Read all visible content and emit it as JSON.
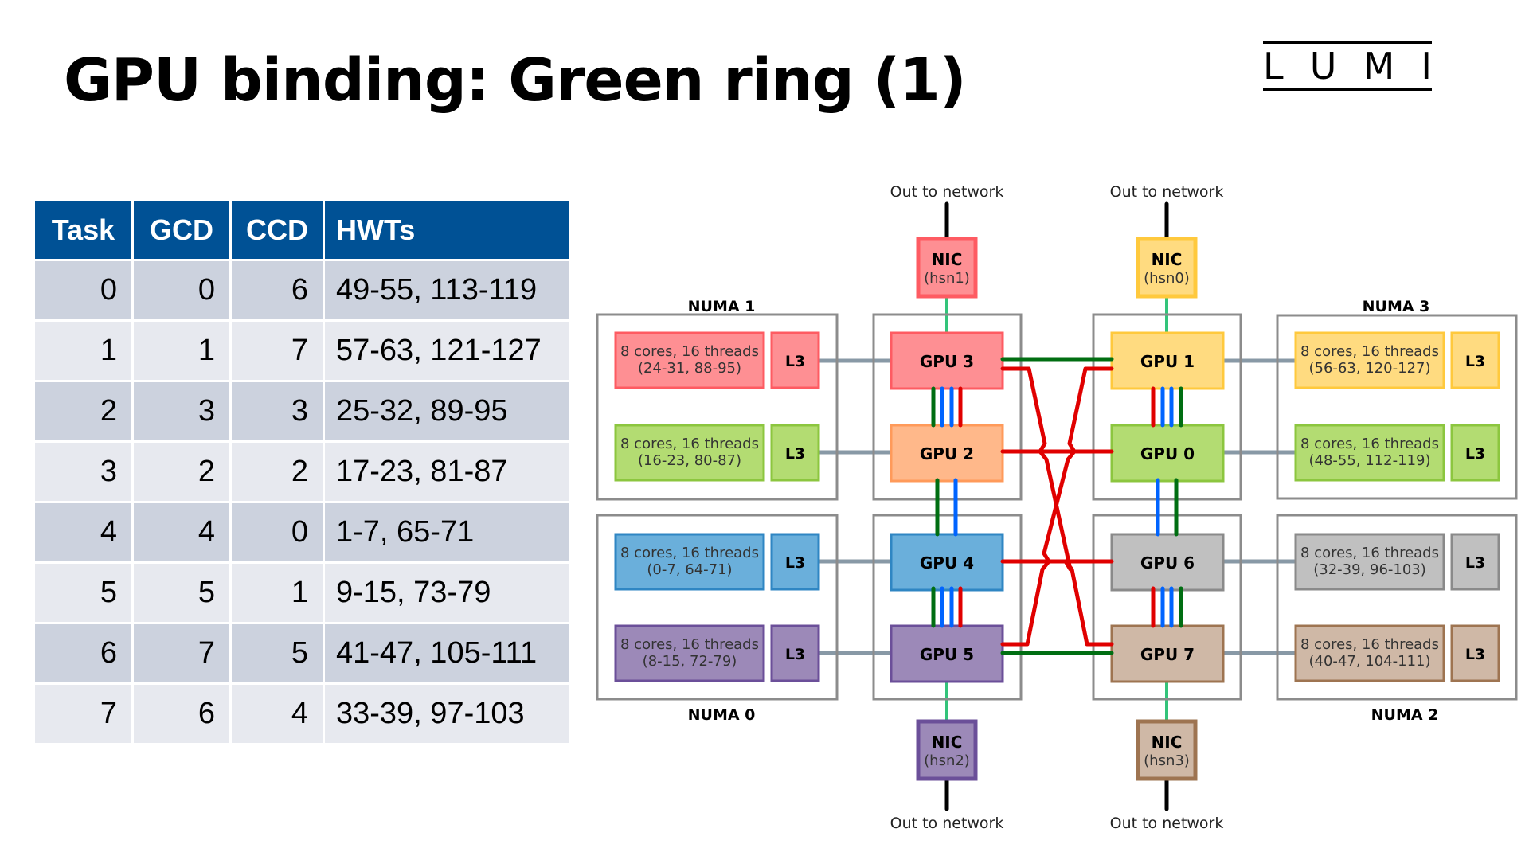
{
  "title": "GPU binding: Green ring (1)",
  "logo": {
    "letters": [
      "L",
      "U",
      "M",
      "I"
    ]
  },
  "table": {
    "headers": [
      "Task",
      "GCD",
      "CCD",
      "HWTs"
    ],
    "rows": [
      [
        "0",
        "0",
        "6",
        "49-55, 113-119"
      ],
      [
        "1",
        "1",
        "7",
        "57-63, 121-127"
      ],
      [
        "2",
        "3",
        "3",
        "25-32, 89-95"
      ],
      [
        "3",
        "2",
        "2",
        "17-23, 81-87"
      ],
      [
        "4",
        "4",
        "0",
        "1-7, 65-71"
      ],
      [
        "5",
        "5",
        "1",
        "9-15, 73-79"
      ],
      [
        "6",
        "7",
        "5",
        "41-47, 105-111"
      ],
      [
        "7",
        "6",
        "4",
        "33-39, 97-103"
      ]
    ]
  },
  "diagram": {
    "network_label": "Out to network",
    "numa": {
      "numa1": "NUMA 1",
      "numa3": "NUMA 3",
      "numa0": "NUMA 0",
      "numa2": "NUMA 2"
    },
    "nics": {
      "hsn1": {
        "title": "NIC",
        "name": "(hsn1)",
        "fill": "#fe8f93",
        "stroke": "#fe5b62"
      },
      "hsn0": {
        "title": "NIC",
        "name": "(hsn0)",
        "fill": "#ffdb80",
        "stroke": "#ffc93d"
      },
      "hsn2": {
        "title": "NIC",
        "name": "(hsn2)",
        "fill": "#9c89b8",
        "stroke": "#6b4f99"
      },
      "hsn3": {
        "title": "NIC",
        "name": "(hsn3)",
        "fill": "#cfb8a6",
        "stroke": "#9e7451"
      }
    },
    "gpus": {
      "gpu3": {
        "label": "GPU 3",
        "fill": "#fe8f93",
        "stroke": "#fe5b62"
      },
      "gpu2": {
        "label": "GPU 2",
        "fill": "#ffb88a",
        "stroke": "#ff9a5a"
      },
      "gpu4": {
        "label": "GPU 4",
        "fill": "#6aafdb",
        "stroke": "#2f86c3"
      },
      "gpu5": {
        "label": "GPU 5",
        "fill": "#9c89b8",
        "stroke": "#6b4f99"
      },
      "gpu1": {
        "label": "GPU 1",
        "fill": "#ffdb80",
        "stroke": "#ffc93d"
      },
      "gpu0": {
        "label": "GPU 0",
        "fill": "#b3dc72",
        "stroke": "#8cc63f"
      },
      "gpu6": {
        "label": "GPU 6",
        "fill": "#c0c0c0",
        "stroke": "#8a8a8a"
      },
      "gpu7": {
        "label": "GPU 7",
        "fill": "#cfb8a6",
        "stroke": "#9e7451"
      }
    },
    "ccds": {
      "n1_top": {
        "line1": "8  cores, 16 threads",
        "line2": "(24-31, 88-95)",
        "l3": "L3"
      },
      "n1_bot": {
        "line1": "8  cores, 16 threads",
        "line2": "(16-23, 80-87)",
        "l3": "L3"
      },
      "n0_top": {
        "line1": "8  cores, 16 threads",
        "line2": "(0-7, 64-71)",
        "l3": "L3"
      },
      "n0_bot": {
        "line1": "8  cores, 16 threads",
        "line2": "(8-15, 72-79)",
        "l3": "L3"
      },
      "n3_top": {
        "line1": "8  cores, 16 threads",
        "line2": "(56-63, 120-127)",
        "l3": "L3"
      },
      "n3_bot": {
        "line1": "8  cores, 16 threads",
        "line2": "(48-55, 112-119)",
        "l3": "L3"
      },
      "n2_top": {
        "line1": "8  cores, 16 threads",
        "line2": "(32-39, 96-103)",
        "l3": "L3"
      },
      "n2_bot": {
        "line1": "8  cores, 16 threads",
        "line2": "(40-47, 104-111)",
        "l3": "L3"
      }
    },
    "link_colors": {
      "green": "#006e12",
      "blue": "#0064ff",
      "red": "#e00000",
      "nic_link": "#33c47a",
      "cpu_link": "#8899a6",
      "network": "#000000",
      "box_border": "#8c8c8c"
    }
  }
}
